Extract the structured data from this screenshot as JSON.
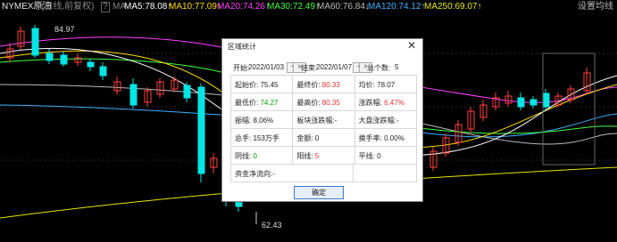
{
  "header": {
    "symbol": "NYMEX原油",
    "mode": "(日线,前复权)",
    "help": "?",
    "ma_label": "MA",
    "ma5": "MA5:78.08↑",
    "ma10": "MA10:77.09↑",
    "ma20": "MA20:74.26↑",
    "ma30": "MA30:72.49↑",
    "ma60": "MA60:76.84↓",
    "ma120": "MA120:74.12↑",
    "ma250": "MA250:69.07↑",
    "settings": "设置均线"
  },
  "chart": {
    "high_label": "84.97",
    "low_label": "62.43",
    "colors": {
      "up": "#ff4040",
      "down": "#00e5e5",
      "ma5": "#ffffff",
      "ma10": "#ffdd00",
      "ma20": "#ff40ff",
      "ma30": "#40ff40",
      "ma60": "#bbbbbb",
      "ma120": "#3fb0ff",
      "ma250": "#e6e600"
    }
  },
  "dialog": {
    "title": "区域统计",
    "start_label": "开始:",
    "start_date": "2022/01/03",
    "end_label": "结束:",
    "end_date": "2022/01/07",
    "prev": "<",
    "next": ">",
    "count_label": "总个数:",
    "count": "5",
    "open_label": "起始价:",
    "open": "75.45",
    "close_label": "最终价:",
    "close": "80.33",
    "avg_label": "均价:",
    "avg": "78.07",
    "low_label": "最低价:",
    "low": "74.27",
    "high_label": "最高价:",
    "high": "80.35",
    "change_label": "涨跌幅:",
    "change": "6.47%",
    "amp_label": "振幅:",
    "amp": "8.06%",
    "sector_label": "板块涨跌幅:",
    "sector": "-",
    "market_label": "大盘涨跌幅:",
    "market": "-",
    "vol_label": "总手:",
    "vol": "153万手",
    "amount_label": "金额:",
    "amount": "0",
    "turnover_label": "换手率:",
    "turnover": "0.00%",
    "neg_label": "阴线:",
    "neg": "0",
    "pos_label": "阳线:",
    "pos": "5",
    "flat_label": "平线:",
    "flat": "0",
    "flow_label": "资金净流向:",
    "flow": "-",
    "ok": "确定"
  }
}
